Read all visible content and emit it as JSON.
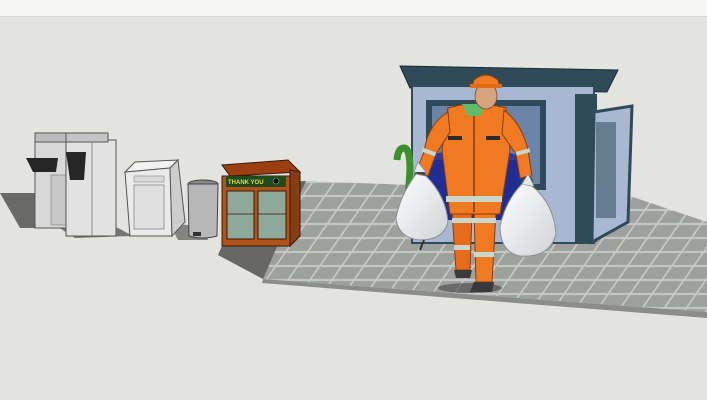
{
  "scene": {
    "type": "3d-model-render",
    "subject": "sanitation-worker-with-bins-and-kiosk",
    "recycling_bin_sign": "THANK YOU",
    "colors": {
      "background": "#e3e3df",
      "uniform_orange": "#f07a22",
      "reflective_stripe": "#c9d6c9",
      "kiosk_wall": "#a9b8d2",
      "kiosk_frame": "#2f4b5a",
      "paving": "#a4a6a3",
      "bin_wood": "#b0531b"
    }
  }
}
